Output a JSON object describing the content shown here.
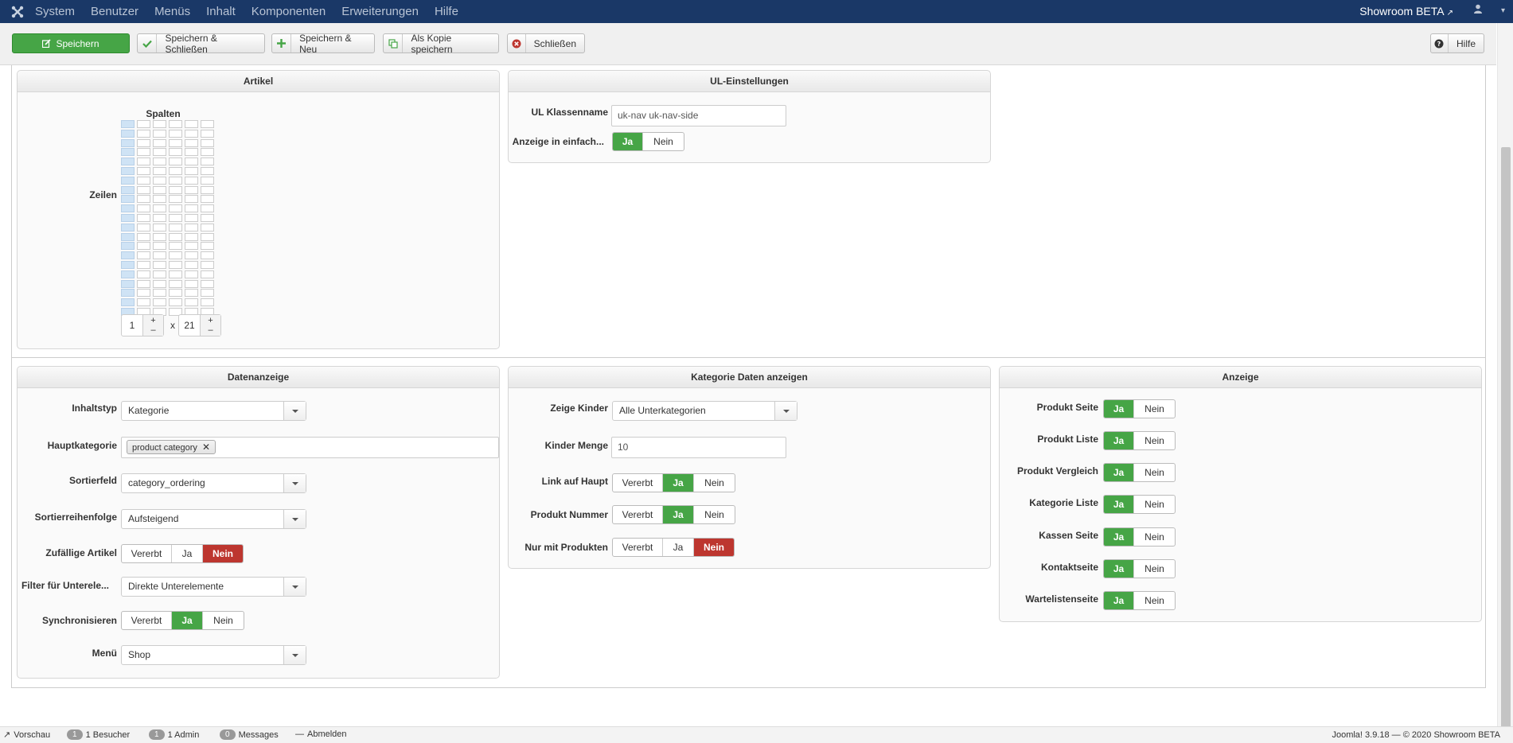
{
  "topbar": {
    "menu": [
      "System",
      "Benutzer",
      "Menüs",
      "Inhalt",
      "Komponenten",
      "Erweiterungen",
      "Hilfe"
    ],
    "site_name": "Showroom BETA"
  },
  "toolbar": {
    "save": "Speichern",
    "save_close": "Speichern & Schließen",
    "save_new": "Speichern & Neu",
    "save_copy": "Als Kopie speichern",
    "close": "Schließen",
    "help": "Hilfe"
  },
  "artikel": {
    "title": "Artikel",
    "columns_label": "Spalten",
    "rows_label": "Zeilen",
    "columns_value": "1",
    "times": "x",
    "rows_value": "21",
    "plus": "+",
    "minus": "–"
  },
  "ul": {
    "title": "UL-Einstellungen",
    "class_label": "UL Klassenname",
    "class_value": "uk-nav uk-nav-side",
    "simple_label": "Anzeige in einfach...",
    "yes": "Ja",
    "no": "Nein"
  },
  "daten": {
    "title": "Datenanzeige",
    "content_type_label": "Inhaltstyp",
    "content_type_value": "Kategorie",
    "main_cat_label": "Hauptkategorie",
    "main_cat_tag": "product category",
    "sort_field_label": "Sortierfeld",
    "sort_field_value": "category_ordering",
    "sort_order_label": "Sortierreihenfolge",
    "sort_order_value": "Aufsteigend",
    "random_label": "Zufällige Artikel",
    "filter_label": "Filter für Unterele...",
    "filter_value": "Direkte Unterelemente",
    "sync_label": "Synchronisieren",
    "menu_label": "Menü",
    "menu_value": "Shop",
    "inherit": "Vererbt",
    "yes": "Ja",
    "no": "Nein"
  },
  "kategorie": {
    "title": "Kategorie Daten anzeigen",
    "children_label": "Zeige Kinder",
    "children_value": "Alle Unterkategorien",
    "amount_label": "Kinder Menge",
    "amount_value": "10",
    "link_label": "Link auf Haupt",
    "number_label": "Produkt Nummer",
    "only_label": "Nur mit Produkten",
    "inherit": "Vererbt",
    "yes": "Ja",
    "no": "Nein"
  },
  "anzeige": {
    "title": "Anzeige",
    "rows": [
      "Produkt Seite",
      "Produkt Liste",
      "Produkt Vergleich",
      "Kategorie Liste",
      "Kassen Seite",
      "Kontaktseite",
      "Wartelistenseite"
    ],
    "yes": "Ja",
    "no": "Nein"
  },
  "status": {
    "preview": "Vorschau",
    "visitors_count": "1",
    "visitors": "1 Besucher",
    "admin_count": "1",
    "admin": "1 Admin",
    "messages_count": "0",
    "messages": "Messages",
    "logout": "Abmelden",
    "version": "Joomla! 3.9.18",
    "copyright": "© 2020 Showroom BETA"
  },
  "colors": {
    "nav": "#1a3867",
    "success": "#46a546",
    "danger": "#bd362f"
  }
}
